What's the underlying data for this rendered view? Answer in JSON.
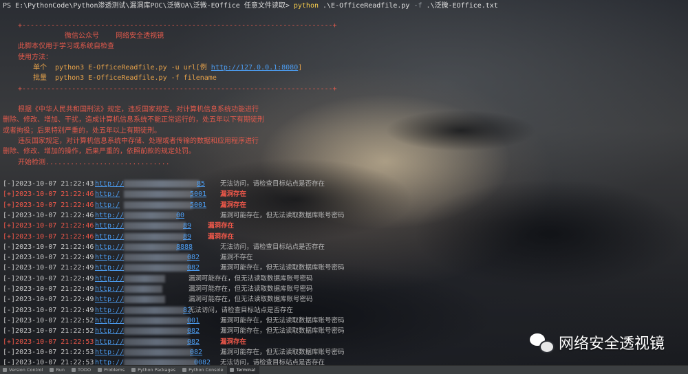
{
  "command": {
    "prompt": "PS E:\\PythonCode\\Python渗透测试\\漏洞库POC\\泛微OA\\泛微-EOffice 任意文件读取> ",
    "program": "python",
    "script": " .\\E-OfficeReadfile.py ",
    "flag": "-f",
    "file": " .\\泛微-EOffice.txt"
  },
  "banner": {
    "border": "+---------------------------------------------------------------------------+",
    "wechat_label": "微信公众号",
    "wechat_name": "网络安全透视镜",
    "purpose": "此脚本仅用于学习或系统自检查",
    "usage_title": "使用方法：",
    "single_label": "单个",
    "single_cmd": "python3 E-OfficeReadfile.py -u url[例 ",
    "single_url": "http://127.0.0.1:8080",
    "single_end": "]",
    "batch_label": "批量",
    "batch_cmd": "python3 E-OfficeReadfile.py -f filename",
    "legal_1": "根据《中华人民共和国刑法》规定，违反国家规定，对计算机信息系统功能进行",
    "legal_2": "删除、修改、增加、干扰，造成计算机信息系统不能正常运行的，处五年以下有期徒刑",
    "legal_3": "或者拘役；后果特别严重的，处五年以上有期徒刑。",
    "legal_4": "违反国家规定，对计算机信息系统中存储、处理或者传输的数据和应用程序进行",
    "legal_5": "删除、修改、增加的操作，后果严重的，依照前款的规定处罚。",
    "start": "开始检测.............................."
  },
  "results": [
    {
      "status": "[-]",
      "time": "2023-10-07 21:22:43",
      "url_head": "http://",
      "url_tail": "85",
      "message": "无法访问，请检查目标站点是否存在",
      "positive": false
    },
    {
      "status": "[+]",
      "time": "2023-10-07 21:22:46",
      "url_head": "http:/",
      "url_tail": "5001",
      "message": "漏洞存在",
      "positive": true
    },
    {
      "status": "[+]",
      "time": "2023-10-07 21:22:46",
      "url_head": "http:/",
      "url_tail": "5001",
      "message": "漏洞存在",
      "positive": true
    },
    {
      "status": "[-]",
      "time": "2023-10-07 21:22:46",
      "url_head": "http://",
      "url_tail": "00",
      "message": "漏洞可能存在，但无法读取数据库账号密码",
      "positive": false
    },
    {
      "status": "[+]",
      "time": "2023-10-07 21:22:46",
      "url_head": "http://",
      "url_tail": "89",
      "message": "漏洞存在",
      "positive": true
    },
    {
      "status": "[+]",
      "time": "2023-10-07 21:22:46",
      "url_head": "http://",
      "url_tail": "89",
      "message": "漏洞存在",
      "positive": true
    },
    {
      "status": "[-]",
      "time": "2023-10-07 21:22:46",
      "url_head": "http://",
      "url_tail": "8888",
      "message": "无法访问，请检查目标站点是否存在",
      "positive": false
    },
    {
      "status": "[-]",
      "time": "2023-10-07 21:22:49",
      "url_head": "http://",
      "url_tail": "082",
      "message": "漏洞不存在",
      "positive": false
    },
    {
      "status": "[-]",
      "time": "2023-10-07 21:22:49",
      "url_head": "http://",
      "url_tail": "082",
      "message": "漏洞可能存在，但无法读取数据库账号密码",
      "positive": false
    },
    {
      "status": "[-]",
      "time": "2023-10-07 21:22:49",
      "url_head": "http://",
      "url_tail": "",
      "message": "漏洞可能存在，但无法读取数据库账号密码",
      "positive": false
    },
    {
      "status": "[-]",
      "time": "2023-10-07 21:22:49",
      "url_head": "http://",
      "url_tail": "",
      "message": "漏洞可能存在，但无法读取数据库账号密码",
      "positive": false
    },
    {
      "status": "[-]",
      "time": "2023-10-07 21:22:49",
      "url_head": "http://",
      "url_tail": "",
      "message": "漏洞可能存在，但无法读取数据库账号密码",
      "positive": false
    },
    {
      "status": "[-]",
      "time": "2023-10-07 21:22:49",
      "url_head": "http://",
      "url_tail": "82",
      "message": "无法访问，请检查目标站点是否存在",
      "positive": false
    },
    {
      "status": "[-]",
      "time": "2023-10-07 21:22:52",
      "url_head": "http://",
      "url_tail": "001",
      "message": "漏洞可能存在，但无法读取数据库账号密码",
      "positive": false
    },
    {
      "status": "[-]",
      "time": "2023-10-07 21:22:52",
      "url_head": "http://",
      "url_tail": "082",
      "message": "漏洞可能存在，但无法读取数据库账号密码",
      "positive": false
    },
    {
      "status": "[+]",
      "time": "2023-10-07 21:22:53",
      "url_head": "http://",
      "url_tail": "082",
      "message": "漏洞存在",
      "positive": true
    },
    {
      "status": "[-]",
      "time": "2023-10-07 21:22:53",
      "url_head": "http://",
      "url_tail": "082",
      "message": "漏洞可能存在，但无法读取数据库账号密码",
      "positive": false
    },
    {
      "status": "[-]",
      "time": "2023-10-07 21:22:53",
      "url_head": "http://",
      "url_tail": "0082",
      "message": "无法访问，请检查目标站点是否存在",
      "positive": false
    }
  ],
  "statusbar": {
    "items": [
      "Version Control",
      "Run",
      "TODO",
      "Problems",
      "Python Packages",
      "Python Console",
      "Terminal"
    ],
    "active": "Terminal"
  },
  "watermark": {
    "text": "网络安全透视镜"
  },
  "icons": {
    "watermark_logo": "wechat-icon",
    "statusbar": [
      "branch-icon",
      "run-icon",
      "todo-icon",
      "problems-icon",
      "packages-icon",
      "python-console-icon",
      "terminal-icon"
    ]
  },
  "colors": {
    "banner_red": "#e35a4c",
    "positive_red": "#f0584a",
    "link_blue": "#4c9cf0",
    "command_yellow": "#f2c94c"
  }
}
